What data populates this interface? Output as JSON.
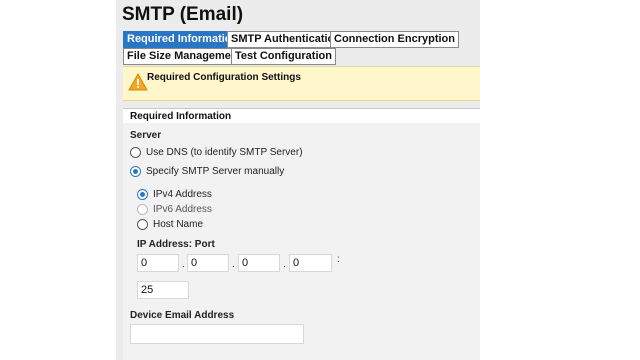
{
  "page": {
    "title": "SMTP (Email)"
  },
  "tabs": [
    {
      "label": "Required Information",
      "active": true
    },
    {
      "label": "SMTP Authentication",
      "active": false
    },
    {
      "label": "Connection Encryption",
      "active": false
    },
    {
      "label": "File Size Management",
      "active": false
    },
    {
      "label": "Test Configuration",
      "active": false
    }
  ],
  "alert": {
    "icon": "warning-icon",
    "text": "Required Configuration Settings"
  },
  "section": {
    "title": "Required Information"
  },
  "server": {
    "label": "Server",
    "options": [
      {
        "label": "Use DNS (to identify SMTP Server)",
        "checked": false
      },
      {
        "label": "Specify SMTP Server manually",
        "checked": true
      }
    ]
  },
  "address_type": {
    "options": [
      {
        "label": "IPv4 Address",
        "checked": true,
        "disabled": false
      },
      {
        "label": "IPv6 Address",
        "checked": false,
        "disabled": true
      },
      {
        "label": "Host Name",
        "checked": false,
        "disabled": false
      }
    ]
  },
  "ip_port": {
    "label": "IP Address: Port",
    "octets": [
      "0",
      "0",
      "0",
      "0"
    ],
    "dot": ".",
    "colon": ":",
    "port": "25"
  },
  "device_email": {
    "label": "Device Email Address",
    "value": ""
  },
  "colors": {
    "accent": "#2a76c6",
    "alert_bg": "#fff7cc",
    "panel_bg": "#ececec"
  }
}
